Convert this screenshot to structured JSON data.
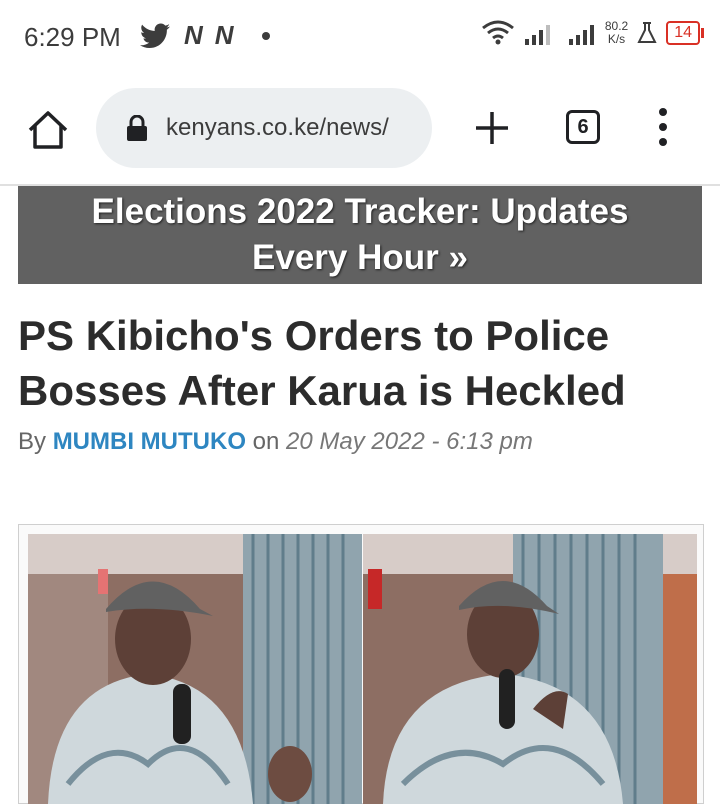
{
  "status_bar": {
    "time": "6:29 PM",
    "notification_icons": [
      "twitter-icon",
      "n-app-icon",
      "n-app-icon"
    ],
    "n_glyph": "N",
    "speed_value": "80.2",
    "speed_unit": "K/s",
    "battery": "14"
  },
  "browser": {
    "url": "kenyans.co.ke/news/",
    "tab_count": "6"
  },
  "banner": {
    "text": "Elections 2022 Tracker: Updates Every Hour »"
  },
  "article": {
    "headline": "PS Kibicho's Orders to Police Bosses After Karua is Heckled",
    "by_label": "By",
    "author": "MUMBI MUTUKO",
    "on_label": "on",
    "date": "20 May 2022 - 6:13 pm"
  },
  "colors": {
    "banner_bg": "#616161",
    "author_link": "#2e86c1",
    "battery_low": "#d93025"
  }
}
